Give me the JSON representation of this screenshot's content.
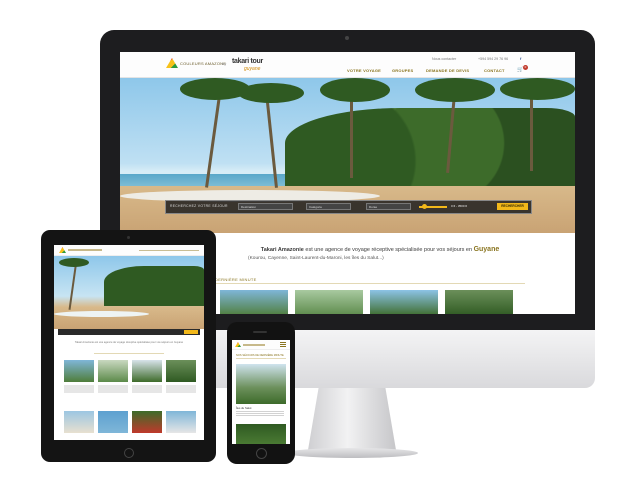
{
  "desktop": {
    "logo": {
      "brand1": "COULEURS AMAZONE",
      "separator": "by",
      "brand2": "takari tour",
      "brand2_sub": "guyane"
    },
    "topbar": {
      "contact": "Nous contacter",
      "phone": "+594 594 29 76 96",
      "facebook_icon": "f"
    },
    "nav": [
      "VOTRE VOYAGE",
      "GROUPES",
      "DEMANDE DE DEVIS",
      "CONTACT"
    ],
    "cart_count": "0",
    "search": {
      "title": "RECHERCHEZ VOTRE SÉJOUR",
      "destination": "Destination",
      "category": "Catégorie",
      "duration": "Durée",
      "price_range": "0 € - 3500 €",
      "button": "RECHERCHER"
    },
    "intro": {
      "brand": "Takari Amazonie",
      "text": " est une agence de voyage réceptive spécialisée pour vos séjours en ",
      "country": "Guyane",
      "line2": "(Kourou, Cayenne, Saint-Laurent-du-Maroni, les îles du Salut...)"
    },
    "section_title": "DERNIÈRE MINUTE"
  },
  "tablet": {
    "intro": "Takari Amazonie est une agence de voyage réceptive spécialisée pour vos séjours en Guyane"
  },
  "phone": {
    "section_title": "NOS SÉJOURS DE DERNIÈRE MINUTE",
    "item_title": "Îles du Salut"
  },
  "colors": {
    "accent": "#8a7520",
    "button": "#f2b81a",
    "sky": "#8ec7ea",
    "sand": "#d8b98a"
  }
}
